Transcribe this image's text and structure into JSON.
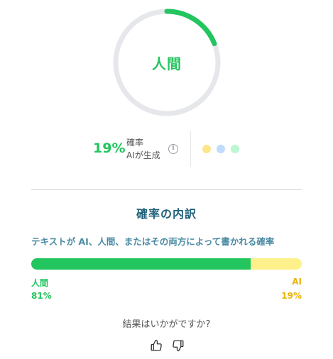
{
  "gauge": {
    "label": "人間",
    "ai_fraction": 0.19,
    "track_color": "#e5e7eb",
    "fill_color": "#22c55e"
  },
  "summary": {
    "ai_percent": "19%",
    "prob_line1": "確率",
    "prob_line2": "AIが生成",
    "info_icon": "info-icon",
    "dots": [
      "#fde68a",
      "#bfdbfe",
      "#bbf7d0"
    ]
  },
  "breakdown": {
    "title": "確率の内訳",
    "description": "テキストが AI、人間、またはその両方によって書かれる確率",
    "human_fraction": 0.81,
    "human_label": "人間",
    "human_percent": "81%",
    "ai_label": "AI",
    "ai_percent": "19%",
    "human_color": "#22c55e",
    "ai_color": "#fef08a"
  },
  "feedback": {
    "question": "結果はいかがですか?",
    "up_icon": "thumbs-up-icon",
    "down_icon": "thumbs-down-icon"
  }
}
